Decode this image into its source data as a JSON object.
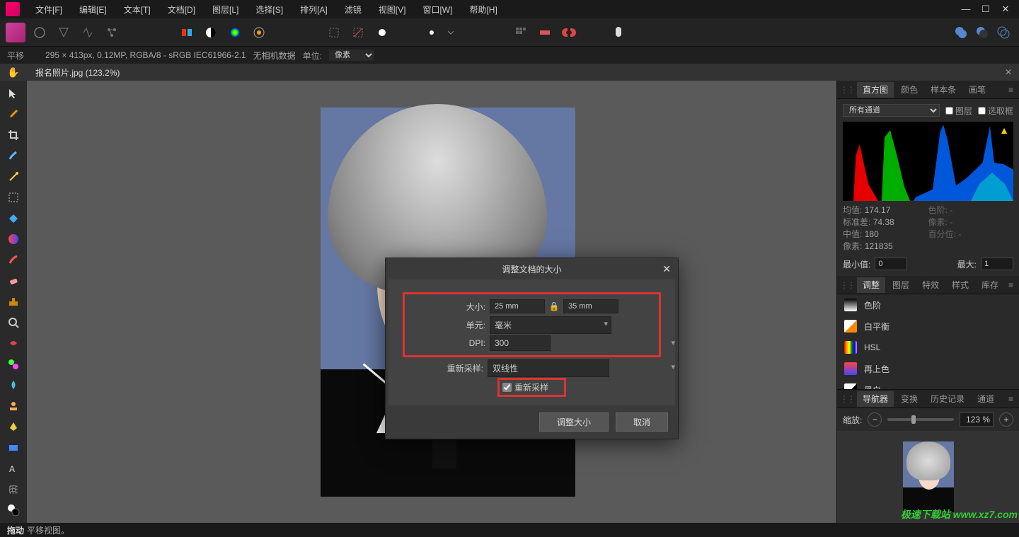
{
  "menu": {
    "items": [
      "文件[F]",
      "编辑[E]",
      "文本[T]",
      "文档[D]",
      "图层[L]",
      "选择[S]",
      "排列[A]",
      "滤镜",
      "视图[V]",
      "窗口[W]",
      "帮助[H]"
    ]
  },
  "infobar": {
    "tool_label": "平移",
    "doc_info": "295 × 413px, 0.12MP, RGBA/8 - sRGB IEC61966-2.1",
    "camera": "无相机数据",
    "unit_label": "单位:",
    "unit_value": "像素"
  },
  "tab": {
    "filename": "报名照片.jpg (123.2%)"
  },
  "dialog": {
    "title": "调整文档的大小",
    "size_label": "大小:",
    "width": "25 mm",
    "height": "35 mm",
    "unit_label": "单元:",
    "unit_value": "毫米",
    "dpi_label": "DPI:",
    "dpi_value": "300",
    "resample_label": "重新采样:",
    "resample_method": "双线性",
    "resample_check": "重新采样",
    "ok": "调整大小",
    "cancel": "取消"
  },
  "panels": {
    "top_tabs": [
      "直方图",
      "颜色",
      "样本条",
      "画笔"
    ],
    "top_active": "直方图",
    "channel_select": "所有通道",
    "layer_check": "图层",
    "select_check": "选取框",
    "stats": {
      "mean_label": "均值:",
      "mean": "174.17",
      "std_label": "标准差:",
      "std": "74.38",
      "median_label": "中值:",
      "median": "180",
      "pixels_label": "像素:",
      "pixels": "121835",
      "tone_label": "色阶:",
      "tone": "-",
      "count_label": "像素:",
      "count": "-",
      "pct_label": "百分位:",
      "pct": "-"
    },
    "min_label": "最小值:",
    "min_val": "0",
    "max_label": "最大:",
    "max_val": "1",
    "mid_tabs": [
      "调整",
      "图层",
      "特效",
      "样式",
      "库存"
    ],
    "mid_active": "调整",
    "adjustments": [
      "色阶",
      "白平衡",
      "HSL",
      "再上色",
      "黑白"
    ],
    "bot_tabs": [
      "导航器",
      "变换",
      "历史记录",
      "通道"
    ],
    "bot_active": "导航器",
    "zoom_label": "缩放:",
    "zoom_value": "123 %"
  },
  "status": {
    "action": "拖动",
    "desc": "平移视图。"
  },
  "watermark": "极速下载站 www.xz7.com"
}
